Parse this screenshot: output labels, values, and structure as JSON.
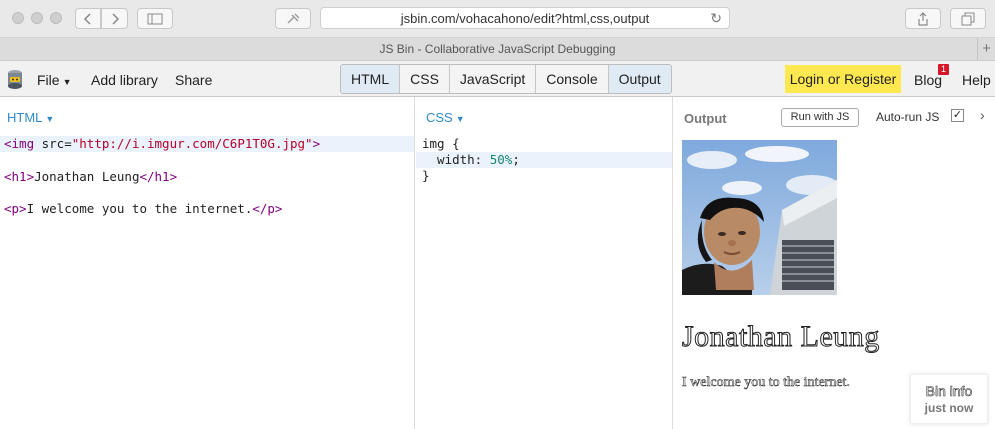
{
  "browser": {
    "url": "jsbin.com/vohacahono/edit?html,css,output",
    "tab_title": "JS Bin - Collaborative JavaScript Debugging",
    "new_tab_label": "+"
  },
  "toolbar": {
    "file_label": "File",
    "add_library_label": "Add library",
    "share_label": "Share",
    "panels": [
      {
        "label": "HTML",
        "active": true
      },
      {
        "label": "CSS",
        "active": false
      },
      {
        "label": "JavaScript",
        "active": false
      },
      {
        "label": "Console",
        "active": false
      },
      {
        "label": "Output",
        "active": true
      }
    ],
    "login_label": "Login or Register",
    "blog_label": "Blog",
    "blog_badge": "1",
    "help_label": "Help",
    "login_color": "#fde84f",
    "badge_color": "#d7162a"
  },
  "html_panel": {
    "label": "HTML",
    "lines": [
      {
        "open": "<img",
        "attr": " src=",
        "string": "\"http://i.imgur.com/C6P1T0G.jpg\"",
        "close": ">"
      },
      {
        "open": "<h1>",
        "text": "Jonathan Leung",
        "close": "</h1>"
      },
      {
        "open": "<p>",
        "text": "I welcome you to the internet.",
        "close": "</p>"
      }
    ]
  },
  "css_panel": {
    "label": "CSS",
    "line1": "img {",
    "line2_prop": "  width: ",
    "line2_value": "50%",
    "line2_end": ";",
    "line3": "}"
  },
  "output_panel": {
    "label": "Output",
    "run_button": "Run with JS",
    "auto_run_label": "Auto-run JS",
    "auto_run_checked": "✓",
    "heading": "Jonathan Leung",
    "paragraph": "I welcome you to the internet.",
    "bin_info_title": "Bin info",
    "bin_info_subtitle": "just now"
  }
}
